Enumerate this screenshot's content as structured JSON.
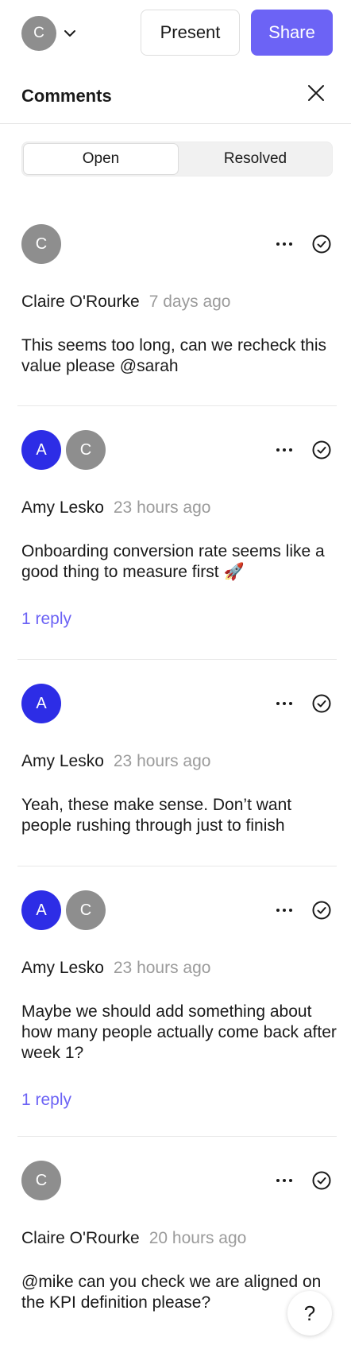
{
  "topbar": {
    "user_initial": "C",
    "present_label": "Present",
    "share_label": "Share",
    "accent": "#6c63f5"
  },
  "panel": {
    "title": "Comments",
    "tabs": [
      {
        "label": "Open",
        "active": true
      },
      {
        "label": "Resolved",
        "active": false
      }
    ]
  },
  "comments": [
    {
      "avatars": [
        {
          "initial": "C",
          "color": "#8e8e8e"
        }
      ],
      "author": "Claire O'Rourke",
      "time": "7 days ago",
      "text": "This seems too long, can we recheck this value please @sarah",
      "replies": ""
    },
    {
      "avatars": [
        {
          "initial": "A",
          "color": "#2d2de6"
        },
        {
          "initial": "C",
          "color": "#8e8e8e"
        }
      ],
      "author": "Amy Lesko",
      "time": "23 hours ago",
      "text": "Onboarding conversion rate seems like a good thing to measure first 🚀",
      "replies": "1 reply"
    },
    {
      "avatars": [
        {
          "initial": "A",
          "color": "#2d2de6"
        }
      ],
      "author": "Amy Lesko",
      "time": "23 hours ago",
      "text": "Yeah, these make sense. Don’t want people rushing through just to finish",
      "replies": ""
    },
    {
      "avatars": [
        {
          "initial": "A",
          "color": "#2d2de6"
        },
        {
          "initial": "C",
          "color": "#8e8e8e"
        }
      ],
      "author": "Amy Lesko",
      "time": "23 hours ago",
      "text": "Maybe we should add something about how many people actually come back after week 1?",
      "replies": "1 reply"
    },
    {
      "avatars": [
        {
          "initial": "C",
          "color": "#8e8e8e"
        }
      ],
      "author": "Claire O'Rourke",
      "time": "20 hours ago",
      "text": "@mike can you check we are aligned on the KPI definition please?",
      "replies": ""
    }
  ],
  "help": {
    "label": "?"
  }
}
